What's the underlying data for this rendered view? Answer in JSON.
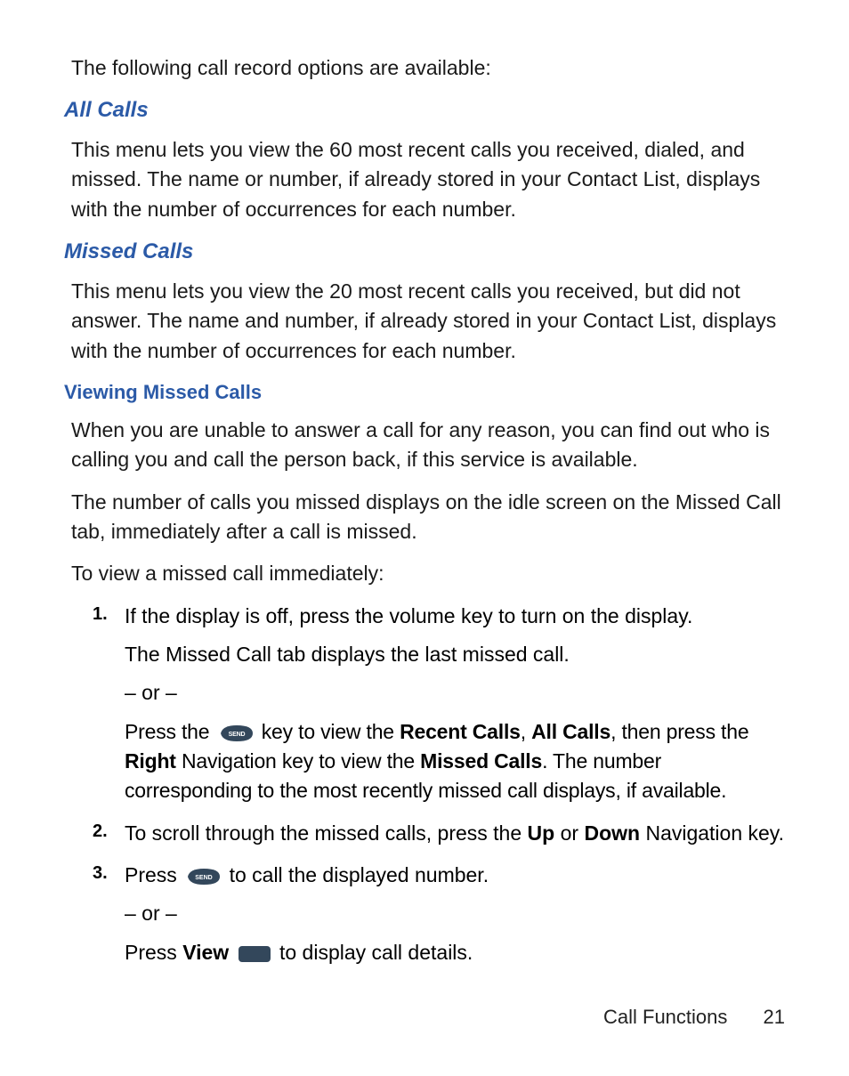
{
  "intro_text": "The following call record options are available:",
  "sections": {
    "all_calls": {
      "heading": "All Calls",
      "body": "This menu lets you view the 60 most recent calls you received, dialed, and missed. The name or number, if already stored in your Contact List, displays with the number of occurrences for each number."
    },
    "missed_calls": {
      "heading": "Missed Calls",
      "body": "This menu lets you view the 20 most recent calls you received, but did not answer. The name and number, if already stored in your Contact List, displays with the number of occurrences for each number."
    },
    "viewing_missed": {
      "heading": "Viewing Missed Calls",
      "para1": "When you are unable to answer a call for any reason, you can find out who is calling you and call the person back, if this service is available.",
      "para2": "The number of calls you missed displays on the idle screen on the Missed Call tab, immediately after a call is missed.",
      "para3": "To view a missed call immediately:"
    }
  },
  "steps": {
    "s1": {
      "num": "1.",
      "line1": "If the display is off, press the volume key to turn on the display.",
      "line2": "The Missed Call tab displays the last missed call.",
      "or": "– or –",
      "line3_pre": "Press the ",
      "line3_mid1": " key to view the ",
      "line3_bold1": "Recent Calls",
      "line3_comma": ", ",
      "line3_bold2": "All Calls",
      "line3_mid2": ", then press the ",
      "line3_bold3": "Right",
      "line3_nav_pre": " Navigation key to view the ",
      "line3_bold4": "Missed Calls",
      "line3_end": ". The number corresponding to the most recently missed call displays, if available."
    },
    "s2": {
      "num": "2.",
      "line_pre": "To scroll through the missed calls, press the ",
      "bold1": "Up",
      "mid": " or ",
      "bold2": "Down",
      "end": " Navigation key."
    },
    "s3": {
      "num": "3.",
      "line1_pre": "Press ",
      "line1_end": " to call the displayed number.",
      "or": "– or –",
      "line2_pre": "Press ",
      "line2_bold": "View",
      "line2_end": " to display call details."
    }
  },
  "icons": {
    "send_label": "SEND"
  },
  "footer": {
    "section": "Call Functions",
    "page": "21"
  }
}
